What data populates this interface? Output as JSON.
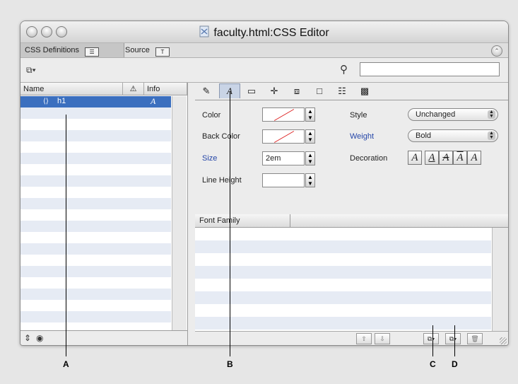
{
  "window": {
    "title": "faculty.html:CSS Editor",
    "tabs": [
      {
        "label": "CSS Definitions",
        "icon": "list-icon"
      },
      {
        "label": "Source",
        "icon": "text-icon"
      }
    ]
  },
  "toolbar": {
    "new_icon": "new-style-icon",
    "search_icon": "search-icon",
    "search_value": ""
  },
  "rule_list": {
    "columns": [
      "Name",
      "Info"
    ],
    "rows": [
      {
        "name": "h1",
        "info": "A"
      }
    ]
  },
  "property_tabs": [
    "pencil",
    "font",
    "background",
    "position",
    "box",
    "border",
    "list",
    "more"
  ],
  "font_props": {
    "color_label": "Color",
    "back_color_label": "Back Color",
    "size_label": "Size",
    "size_value": "2em",
    "line_height_label": "Line Height",
    "line_height_value": "",
    "style_label": "Style",
    "style_value": "Unchanged",
    "weight_label": "Weight",
    "weight_value": "Bold",
    "decoration_label": "Decoration",
    "decoration_buttons": [
      "A",
      "A",
      "A",
      "A",
      "A"
    ]
  },
  "font_family": {
    "header": "Font Family"
  },
  "callouts": [
    "A",
    "B",
    "C",
    "D"
  ]
}
